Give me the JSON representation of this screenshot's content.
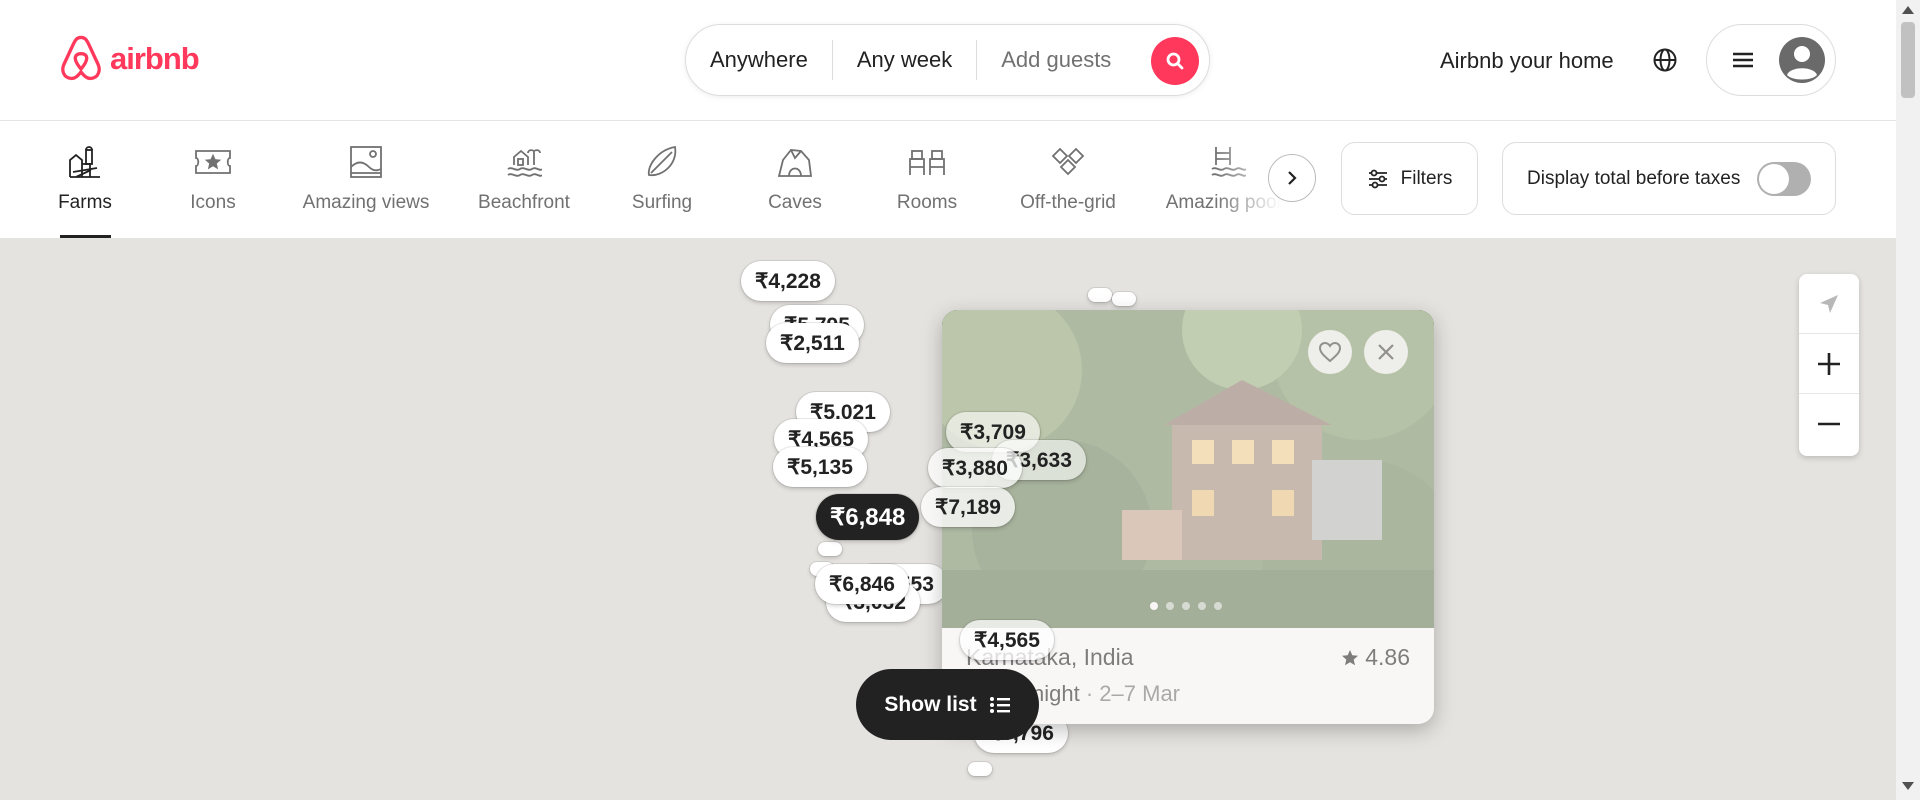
{
  "brand": {
    "name": "airbnb",
    "color": "#ff385c"
  },
  "search": {
    "where": "Anywhere",
    "when": "Any week",
    "guests": "Add guests"
  },
  "header": {
    "host_link": "Airbnb your home"
  },
  "categories": [
    {
      "label": "Farms",
      "icon": "farm-icon",
      "active": true
    },
    {
      "label": "Icons",
      "icon": "ticket-star-icon"
    },
    {
      "label": "Amazing views",
      "icon": "picture-icon"
    },
    {
      "label": "Beachfront",
      "icon": "beach-house-icon"
    },
    {
      "label": "Surfing",
      "icon": "surfboard-icon"
    },
    {
      "label": "Caves",
      "icon": "cave-icon"
    },
    {
      "label": "Rooms",
      "icon": "beds-icon"
    },
    {
      "label": "Off-the-grid",
      "icon": "diamond-grid-icon"
    },
    {
      "label": "Amazing pools",
      "icon": "pool-icon"
    }
  ],
  "filters": {
    "label": "Filters"
  },
  "taxes_toggle": {
    "label": "Display total before taxes",
    "on": false
  },
  "map_pins": [
    {
      "price": "₹4,228"
    },
    {
      "price": "₹5,795"
    },
    {
      "price": "₹2,511"
    },
    {
      "price": "₹5,021"
    },
    {
      "price": "₹4,565"
    },
    {
      "price": "₹5,135"
    },
    {
      "price": "₹6,848",
      "selected": true
    },
    {
      "price": "₹6,846"
    },
    {
      "price": "₹6,553"
    },
    {
      "price": "₹3,032"
    },
    {
      "price": "₹3,709"
    },
    {
      "price": "₹3,633"
    },
    {
      "price": "₹3,880"
    },
    {
      "price": "₹7,189"
    },
    {
      "price": "₹4,565"
    },
    {
      "price": "₹6,796"
    }
  ],
  "listing_card": {
    "location": "Karnataka, India",
    "rating": "4.86",
    "price_suffix": "night",
    "dates": "2–7 Mar"
  },
  "show_list": {
    "label": "Show list"
  }
}
